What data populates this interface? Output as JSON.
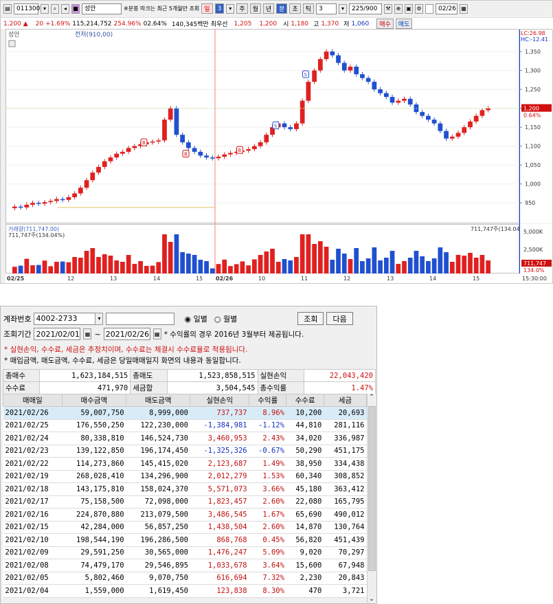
{
  "toolbar": {
    "code": "011300",
    "stock_name": "성안",
    "hint": "※분봉 마크는 최근 5개월만 조회",
    "period_tabs": [
      "일",
      "3",
      "주",
      "월",
      "년",
      "분",
      "초",
      "틱"
    ],
    "interval": "3",
    "count": "225/900",
    "date": "02/26"
  },
  "quote": {
    "price": "1,200",
    "arrow": "▲",
    "change": "20",
    "change_pct": "+1.69%",
    "volume": "115,214,752",
    "vol_ratio": "254.96%",
    "turnover": "02.64%",
    "amount": "140,345백만",
    "priority_label": "최우선",
    "ask": "1,205",
    "bid": "1,200",
    "open_label": "시",
    "open": "1,180",
    "high_label": "고",
    "high": "1,370",
    "low_label": "저",
    "low": "1,060",
    "buy_btn": "매수",
    "sell_btn": "매도"
  },
  "chart_meta": {
    "price_label": "성안",
    "prev_label": "전저(910,00)",
    "lc": "LC:26.98",
    "hc": "HC:-12.41",
    "cur_price_tag": "1,200",
    "cur_pct_tag": "0.64%",
    "vol_title": "거래량(711,747.00)",
    "vol_sub": "711,747주(134.04%)",
    "vol_right": "711,747주(134.04%)",
    "vol_tag": "711,747",
    "vol_tag2": "134.0%",
    "time_label": "15:30:00",
    "markers": [
      "B",
      "S",
      "B",
      "S",
      "B"
    ]
  },
  "chart_data": {
    "type": "candlestick",
    "y_ticks": [
      950,
      1000,
      1050,
      1100,
      1150,
      1200,
      1250,
      1300,
      1350
    ],
    "ylim": [
      905,
      1390
    ],
    "vol_ticks": [
      "5,000K",
      "2,500K"
    ],
    "x_labels": [
      "02/25",
      "12",
      "13",
      "14",
      "15",
      "02/26",
      "10",
      "11",
      "12",
      "13",
      "14",
      "15"
    ],
    "close_series": [
      940,
      938,
      945,
      950,
      948,
      952,
      955,
      960,
      958,
      965,
      975,
      990,
      1010,
      1030,
      1045,
      1060,
      1070,
      1080,
      1085,
      1095,
      1100,
      1105,
      1110,
      1112,
      1115,
      1170,
      1200,
      1130,
      1110,
      1095,
      1085,
      1075,
      1070,
      1068,
      1072,
      1078,
      1082,
      1085,
      1088,
      1092,
      1100,
      1110,
      1130,
      1150,
      1160,
      1150,
      1145,
      1160,
      1220,
      1270,
      1300,
      1330,
      1350,
      1340,
      1320,
      1300,
      1310,
      1290,
      1280,
      1270,
      1250,
      1240,
      1230,
      1215,
      1220,
      1225,
      1210,
      1190,
      1180,
      1170,
      1160,
      1140,
      1120,
      1125,
      1135,
      1150,
      1165,
      1180,
      1195,
      1200
    ]
  },
  "form": {
    "account_label": "계좌번호",
    "account": "4002-2733",
    "radio_daily": "일별",
    "radio_monthly": "월별",
    "btn_query": "조회",
    "btn_next": "다음",
    "period_label": "조회기간",
    "date_from": "2021/02/01",
    "tilde": "~",
    "date_to": "2021/02/26",
    "period_note": "* 수익률의 경우 2016년 3월부터 제공됩니다.",
    "note1": "* 실현손익, 수수료, 세금은 추정치이며, 수수료는 체결시 수수료율로 적용됩니다.",
    "note2": "* 매입금액, 매도금액, 수수료, 세금은 당일매매일지 화면의 내용과 동일합니다."
  },
  "summary": {
    "total_buy_label": "총매수",
    "total_buy": "1,623,184,515",
    "total_sell_label": "총매도",
    "total_sell": "1,523,858,515",
    "realized_label": "실현손익",
    "realized": "22,043,420",
    "fee_label": "수수료",
    "fee": "471,970",
    "tax_label": "세금합",
    "tax": "3,504,545",
    "return_label": "총수익률",
    "return": "1.47%"
  },
  "table": {
    "headers": [
      "매매일",
      "매수금액",
      "매도금액",
      "실현손익",
      "수익률",
      "수수료",
      "세금"
    ],
    "rows": [
      [
        "2021/02/26",
        "59,007,750",
        "8,999,000",
        "737,737",
        "8.96%",
        "10,200",
        "20,693"
      ],
      [
        "2021/02/25",
        "176,550,250",
        "122,230,000",
        "-1,384,981",
        "-1.12%",
        "44,810",
        "281,116"
      ],
      [
        "2021/02/24",
        "80,338,810",
        "146,524,730",
        "3,460,953",
        "2.43%",
        "34,020",
        "336,987"
      ],
      [
        "2021/02/23",
        "139,122,850",
        "196,174,450",
        "-1,325,326",
        "-0.67%",
        "50,290",
        "451,175"
      ],
      [
        "2021/02/22",
        "114,273,860",
        "145,415,020",
        "2,123,687",
        "1.49%",
        "38,950",
        "334,438"
      ],
      [
        "2021/02/19",
        "268,028,410",
        "134,296,900",
        "2,012,279",
        "1.53%",
        "60,340",
        "308,852"
      ],
      [
        "2021/02/18",
        "143,175,810",
        "158,024,370",
        "5,571,073",
        "3.66%",
        "45,180",
        "363,412"
      ],
      [
        "2021/02/17",
        "75,158,500",
        "72,098,000",
        "1,823,457",
        "2.60%",
        "22,080",
        "165,795"
      ],
      [
        "2021/02/16",
        "224,870,880",
        "213,079,500",
        "3,486,545",
        "1.67%",
        "65,690",
        "490,012"
      ],
      [
        "2021/02/15",
        "42,284,000",
        "56,857,250",
        "1,438,504",
        "2.60%",
        "14,870",
        "130,764"
      ],
      [
        "2021/02/10",
        "198,544,190",
        "196,286,500",
        "868,768",
        "0.45%",
        "56,820",
        "451,439"
      ],
      [
        "2021/02/09",
        "29,591,250",
        "30,565,000",
        "1,476,247",
        "5.09%",
        "9,020",
        "70,297"
      ],
      [
        "2021/02/08",
        "74,479,170",
        "29,546,895",
        "1,033,678",
        "3.64%",
        "15,600",
        "67,948"
      ],
      [
        "2021/02/05",
        "5,802,460",
        "9,070,750",
        "616,694",
        "7.32%",
        "2,230",
        "20,843"
      ],
      [
        "2021/02/04",
        "1,559,000",
        "1,619,450",
        "123,838",
        "8.30%",
        "470",
        "3,721"
      ]
    ]
  }
}
